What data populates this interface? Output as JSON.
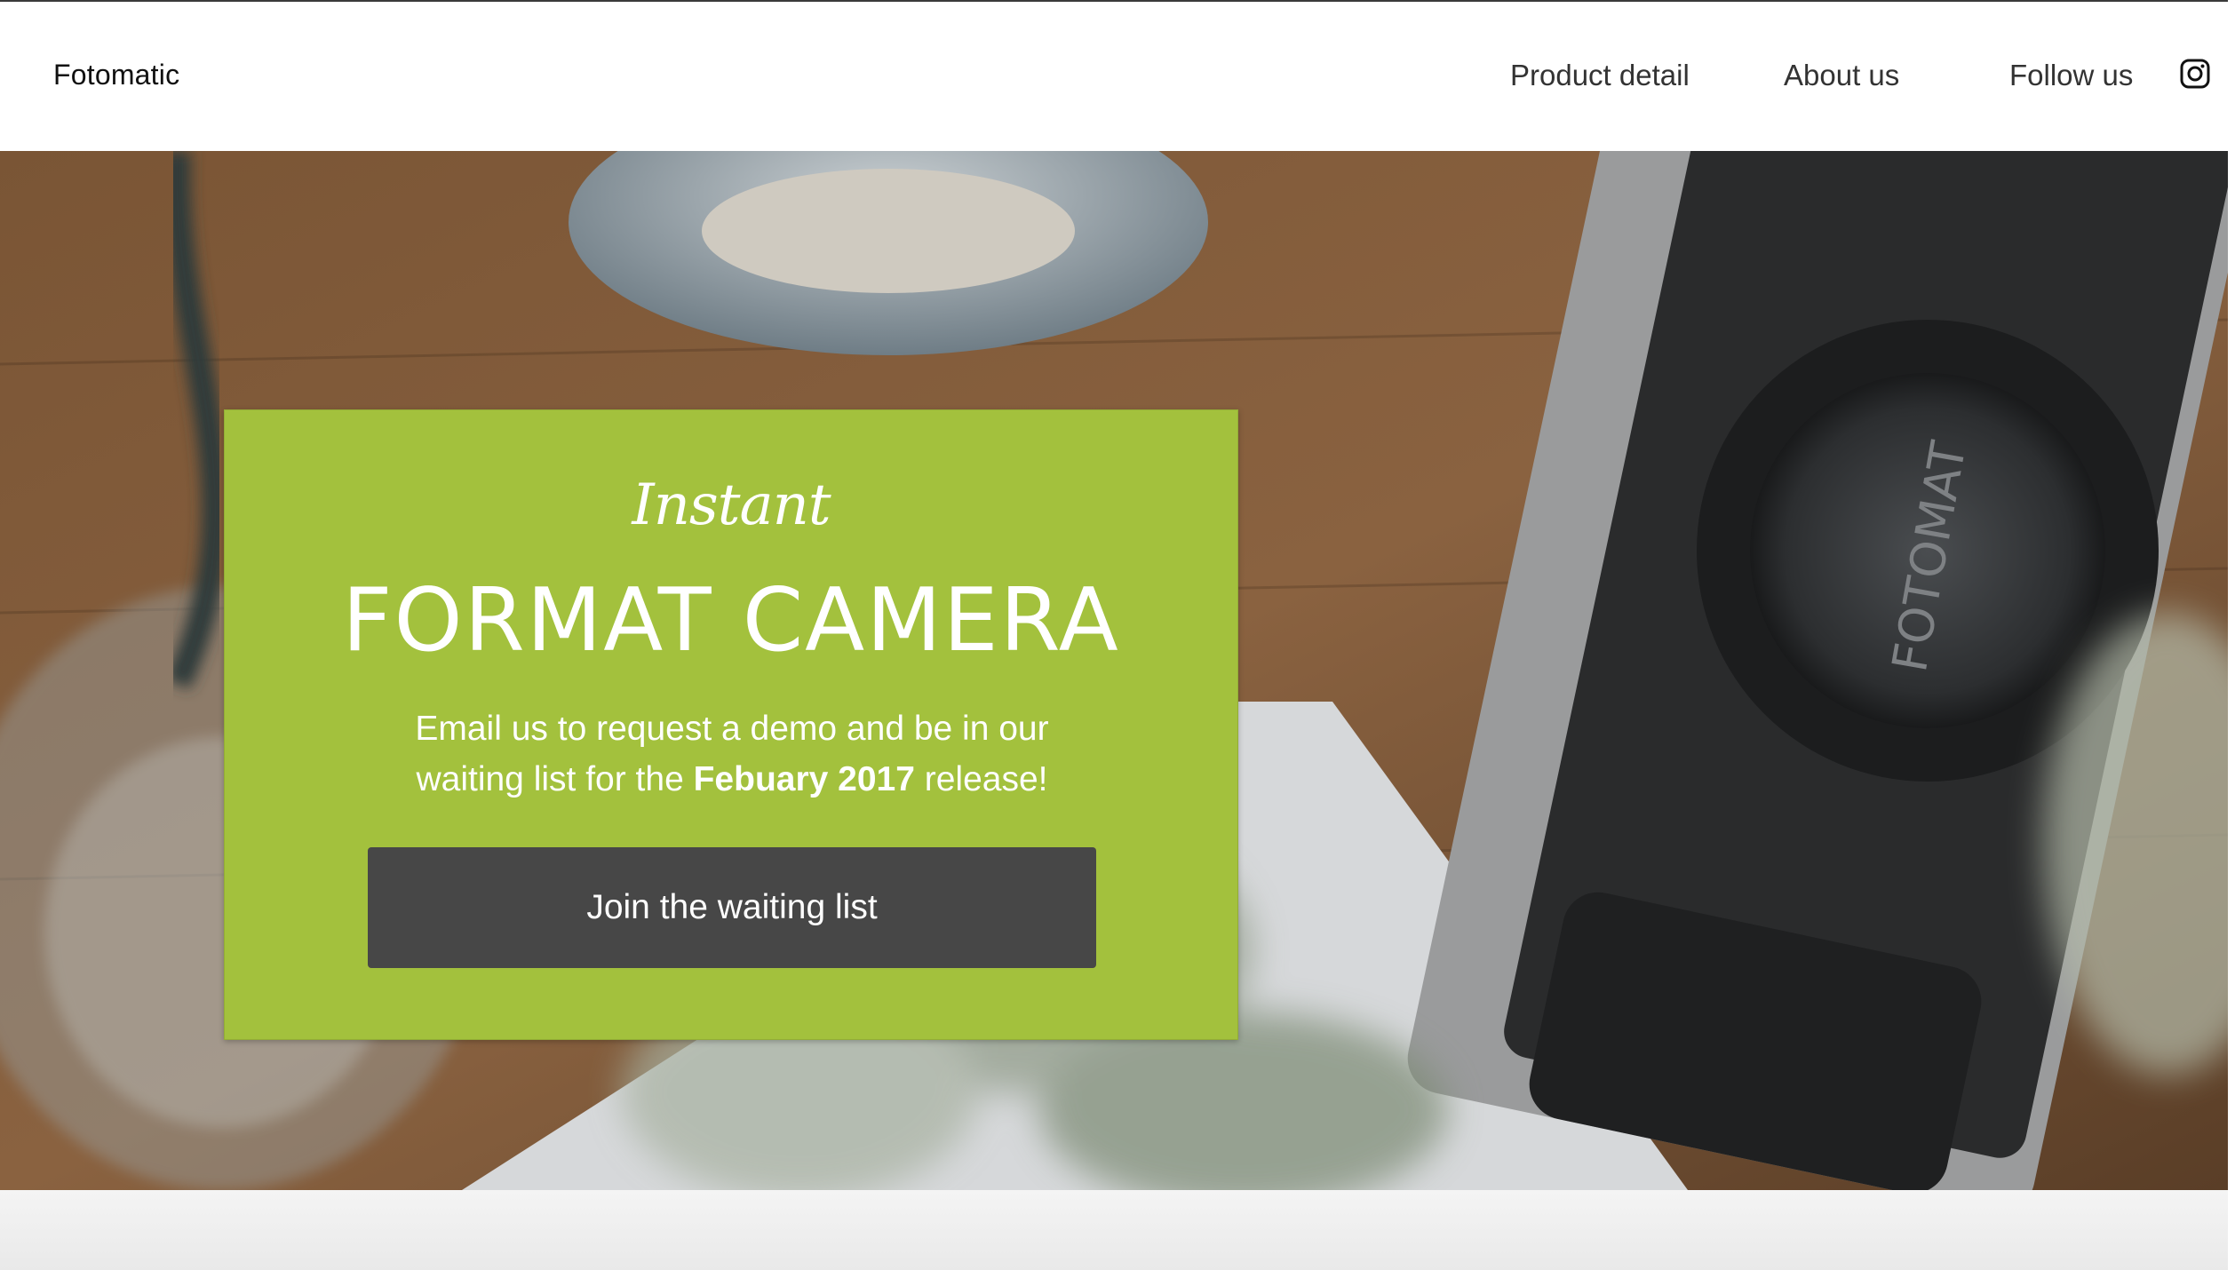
{
  "header": {
    "brand": "Fotomatic",
    "nav": {
      "product_detail": "Product detail",
      "about_us": "About us",
      "follow_us": "Follow us"
    },
    "social_icon": "instagram-icon"
  },
  "hero": {
    "photo_subject": "camera-on-wooden-table",
    "card": {
      "script_title": "Instant",
      "title": "FORMAT CAMERA",
      "text_line1": "Email us to request a demo and be in our",
      "text_line2_pre": "waiting list for the ",
      "text_line2_bold": "Febuary 2017",
      "text_line2_post": " release!",
      "button_label": "Join the waiting list"
    }
  },
  "colors": {
    "card_background": "#a3c13d",
    "button_background": "#474747",
    "text_on_card": "#ffffff",
    "nav_text": "#333333"
  }
}
